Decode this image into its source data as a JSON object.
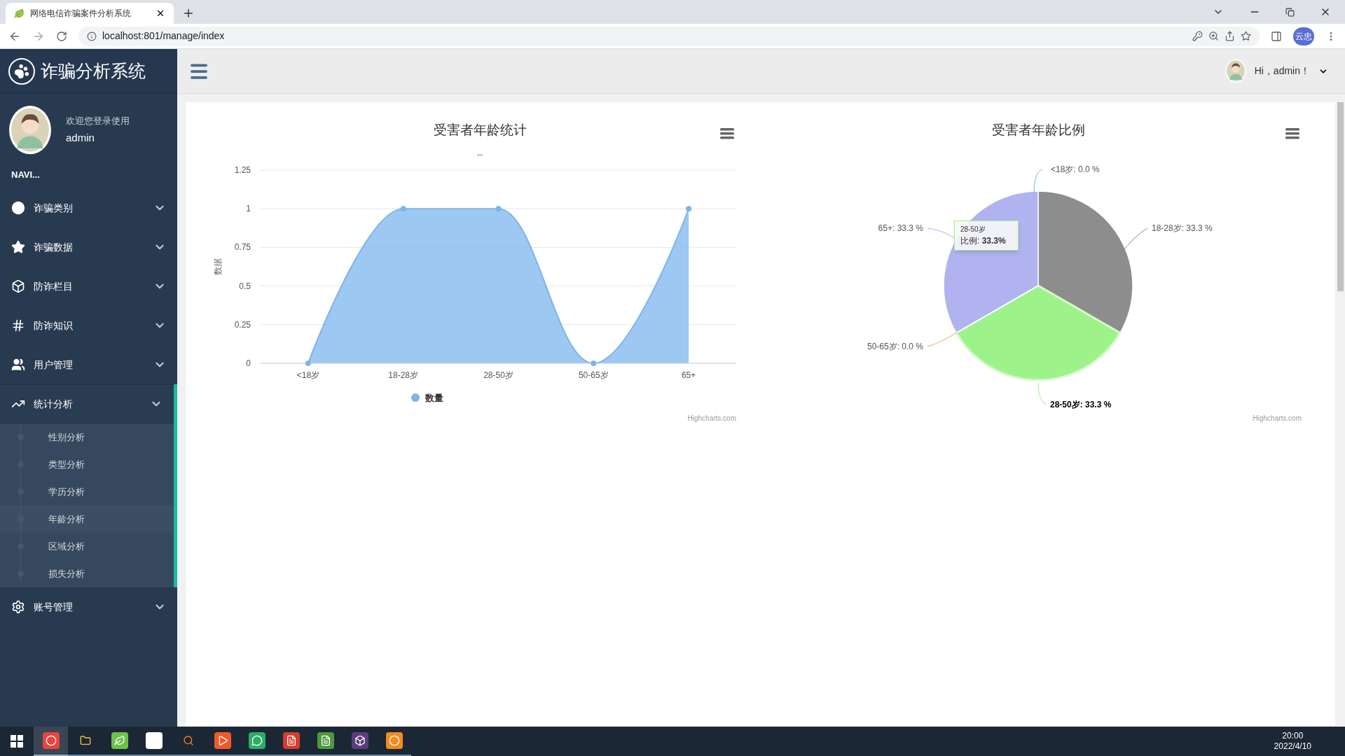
{
  "browser": {
    "tab_title": "网络电信诈骗案件分析系统",
    "url": "localhost:801/manage/index",
    "profile_badge": "云忠"
  },
  "sidebar": {
    "brand": "诈骗分析系统",
    "welcome": "欢迎您登录使用",
    "username": "admin",
    "nav_heading": "NAVI...",
    "items": [
      {
        "label": "诈骗类别",
        "expanded": false
      },
      {
        "label": "诈骗数据",
        "expanded": false
      },
      {
        "label": "防诈栏目",
        "expanded": false
      },
      {
        "label": "防诈知识",
        "expanded": false
      },
      {
        "label": "用户管理",
        "expanded": false
      },
      {
        "label": "统计分析",
        "expanded": true,
        "children": [
          {
            "label": "性别分析",
            "selected": false
          },
          {
            "label": "类型分析",
            "selected": false
          },
          {
            "label": "学历分析",
            "selected": false
          },
          {
            "label": "年龄分析",
            "selected": true
          },
          {
            "label": "区域分析",
            "selected": false
          },
          {
            "label": "损失分析",
            "selected": false
          }
        ]
      },
      {
        "label": "账号管理",
        "expanded": false
      }
    ]
  },
  "header": {
    "greeting": "Hi，admin！"
  },
  "area_chart": {
    "subtitle": "--",
    "credit": "Highcharts.com",
    "chart_data": {
      "type": "area",
      "title": "受害者年龄统计",
      "ylabel": "数据",
      "categories": [
        "<18岁",
        "18-28岁",
        "28-50岁",
        "50-65岁",
        "65+"
      ],
      "series": [
        {
          "name": "数量",
          "color": "#7cb5ec",
          "values": [
            0,
            1,
            1,
            0,
            1
          ]
        }
      ],
      "ylim": [
        0,
        1.25
      ],
      "yticks": [
        0,
        0.25,
        0.5,
        0.75,
        1,
        1.25
      ],
      "grid": true
    }
  },
  "pie_chart": {
    "credit": "Highcharts.com",
    "chart_data": {
      "type": "pie",
      "title": "受害者年龄比例",
      "categories": [
        "<18岁",
        "18-28岁",
        "28-50岁",
        "50-65岁",
        "65+"
      ],
      "values": [
        0,
        33.3,
        33.3,
        0,
        33.3
      ],
      "data_labels": true,
      "value_labels": [
        ": 0.0 %",
        ": 33.3 %",
        ": 33.3 %",
        ": 0.0 %",
        ": 33.3 %"
      ]
    },
    "slices": [
      {
        "color": "#7cb5ec",
        "highlighted": false
      },
      {
        "color": "#8d8d8d",
        "highlighted": false
      },
      {
        "color": "#9df38a",
        "highlighted": true
      },
      {
        "color": "#f7a35c",
        "highlighted": false
      },
      {
        "color": "#b1b3f0",
        "highlighted": false
      }
    ],
    "tooltip": {
      "title": "28-50岁",
      "body": "比例: **33.3%**"
    }
  },
  "taskbar": {
    "time": "20:00",
    "date": "2022/4/10"
  }
}
